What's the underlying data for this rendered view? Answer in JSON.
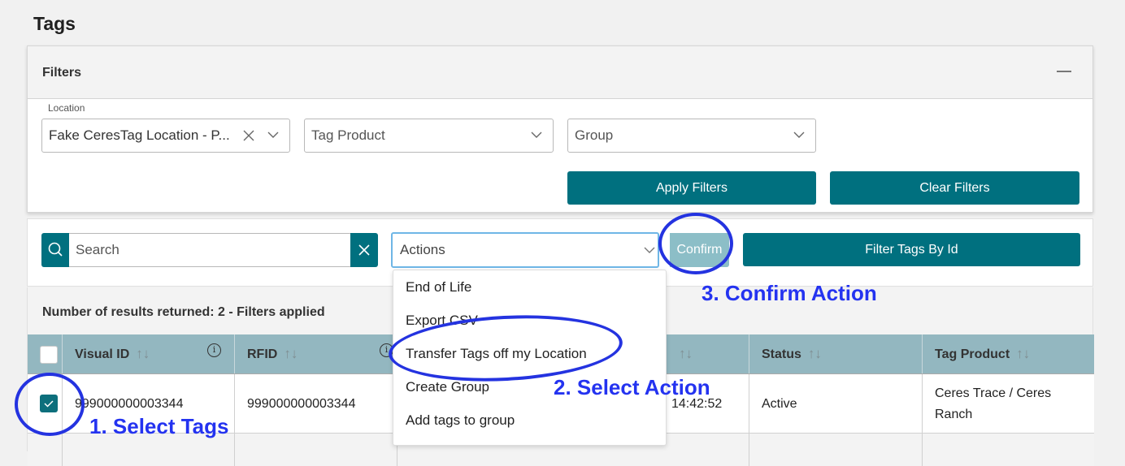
{
  "page": {
    "title": "Tags"
  },
  "filters": {
    "title": "Filters",
    "collapse_icon": "minus-icon",
    "location_label": "Location",
    "location_value": "Fake CeresTag Location - P...",
    "tag_product_placeholder": "Tag Product",
    "group_placeholder": "Group",
    "apply_label": "Apply Filters",
    "clear_label": "Clear Filters"
  },
  "toolbar": {
    "search_placeholder": "Search",
    "actions_placeholder": "Actions",
    "confirm_label": "Confirm",
    "filter_by_id_label": "Filter Tags By Id"
  },
  "results": {
    "summary": "Number of results returned: 2 - Filters applied"
  },
  "actions_menu": {
    "items": [
      "End of Life",
      "Export CSV",
      "Transfer Tags off my Location",
      "Create Group",
      "Add tags to group"
    ]
  },
  "table": {
    "columns": [
      {
        "label": "Visual ID",
        "sort": "↑↓",
        "info": "i"
      },
      {
        "label": "RFID",
        "sort": "↑↓",
        "info": "i"
      },
      {
        "label": "",
        "sort": "↑↓"
      },
      {
        "label": "Status",
        "sort": "↑↓"
      },
      {
        "label": "Tag Product",
        "sort": "↑↓"
      }
    ],
    "rows": [
      {
        "checked": true,
        "visual_id": "999000000003344",
        "rfid": "999000000003344",
        "time": "14:42:52",
        "status": "Active",
        "tag_product": "Ceres Trace / Ceres Ranch"
      }
    ]
  },
  "annotations": {
    "step1": "1. Select Tags",
    "step2": "2. Select Action",
    "step3": "3. Confirm Action"
  },
  "colors": {
    "primary": "#00707f",
    "header": "#93b7c0",
    "annotation": "#2433f0",
    "confirm_disabled": "#8cbec7"
  }
}
